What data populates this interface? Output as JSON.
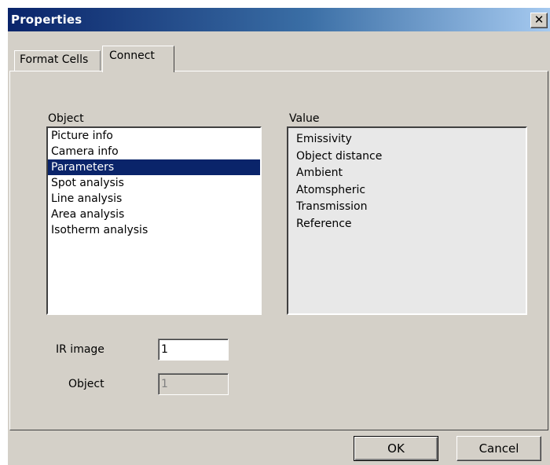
{
  "window": {
    "title": "Properties",
    "close_glyph": "✕",
    "close_icon": "close-icon"
  },
  "tabs": [
    {
      "label": "Format Cells",
      "active": false
    },
    {
      "label": "Connect",
      "active": true
    }
  ],
  "object_list": {
    "label": "Object",
    "items": [
      "Picture info",
      "Camera info",
      "Parameters",
      "Spot analysis",
      "Line analysis",
      "Area analysis",
      "Isotherm analysis"
    ],
    "selected": "Parameters"
  },
  "value_list": {
    "label": "Value",
    "items": [
      "Emissivity",
      "Object distance",
      "Ambient",
      "Atomspheric",
      "Transmission",
      "Reference"
    ]
  },
  "fields": {
    "ir_image": {
      "label": "IR image",
      "value": "1"
    },
    "object": {
      "label": "Object",
      "value": "1"
    }
  },
  "buttons": {
    "ok": "OK",
    "cancel": "Cancel"
  },
  "colors": {
    "face": "#d4d0c8",
    "title_start": "#0a246a",
    "title_end": "#a6caf0",
    "selection": "#0a246a"
  }
}
